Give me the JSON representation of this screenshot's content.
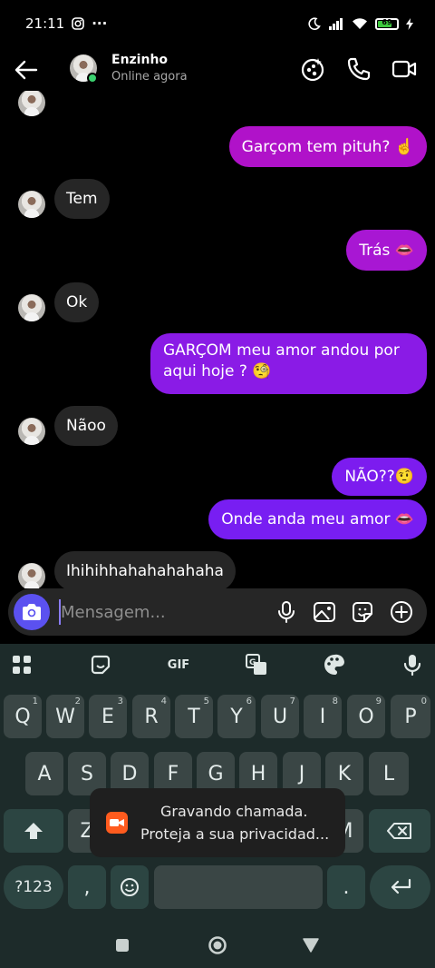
{
  "status_bar": {
    "time": "21:11",
    "more": "···",
    "battery": "69"
  },
  "header": {
    "contact_name": "Enzinho",
    "presence": "Online agora"
  },
  "messages": [
    {
      "dir": "out",
      "text": "Garçom tem pituh? ☝️"
    },
    {
      "dir": "in",
      "text": "Tem"
    },
    {
      "dir": "out",
      "text": "Trás 👄"
    },
    {
      "dir": "in",
      "text": "Ok"
    },
    {
      "dir": "out",
      "line1": "GARÇOM meu amor andou por",
      "line2": "aqui hoje ? 🧐"
    },
    {
      "dir": "in",
      "text": "Nãoo"
    },
    {
      "dir": "out",
      "text": "NÃO??🤨"
    },
    {
      "dir": "out",
      "text": "Onde anda meu amor 👄"
    },
    {
      "dir": "in",
      "text": "Ihihihhahahahahaha"
    }
  ],
  "composer": {
    "placeholder": "Mensagem..."
  },
  "keyboard": {
    "toolbar": {
      "gif": "GIF"
    },
    "row1": [
      {
        "key": "Q",
        "hint": "1"
      },
      {
        "key": "W",
        "hint": "2"
      },
      {
        "key": "E",
        "hint": "3"
      },
      {
        "key": "R",
        "hint": "4"
      },
      {
        "key": "T",
        "hint": "5"
      },
      {
        "key": "Y",
        "hint": "6"
      },
      {
        "key": "U",
        "hint": "7"
      },
      {
        "key": "I",
        "hint": "8"
      },
      {
        "key": "O",
        "hint": "9"
      },
      {
        "key": "P",
        "hint": "0"
      }
    ],
    "row2": [
      "A",
      "S",
      "D",
      "F",
      "G",
      "H",
      "J",
      "K",
      "L"
    ],
    "row3": [
      "Z",
      "M"
    ],
    "row4": {
      "symbols": "?123",
      "comma": ",",
      "period": "."
    }
  },
  "toast": {
    "line1": "Gravando chamada.",
    "line2": "Proteja a sua privacidad..."
  },
  "colors": {
    "bubble_out_pink": "#b012c9",
    "bubble_out_purple": "#7a1df0",
    "bubble_in": "#262626",
    "camera_button": "#5b51f0",
    "keyboard_bg": "#1d2b2a"
  }
}
